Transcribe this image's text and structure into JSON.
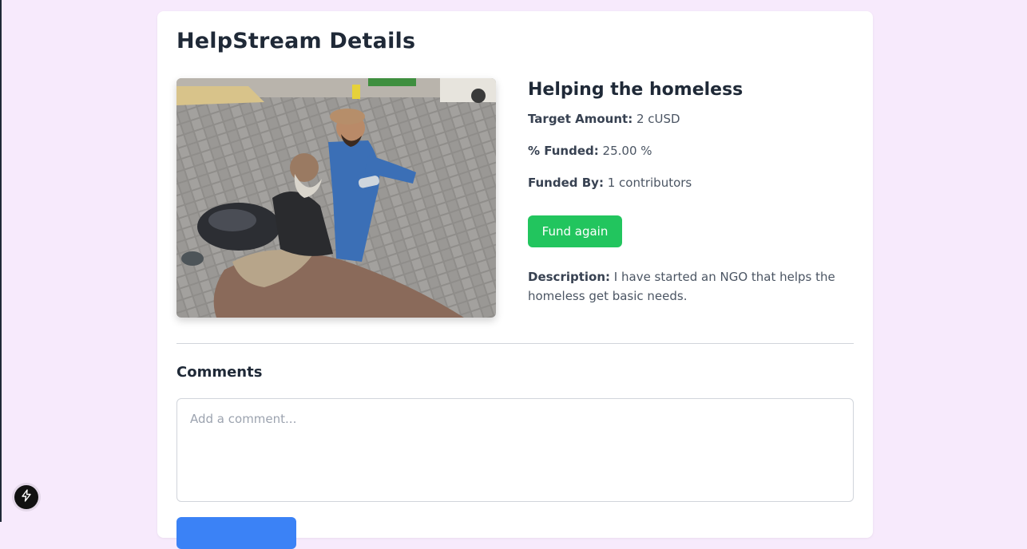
{
  "page": {
    "title": "HelpStream Details"
  },
  "campaign": {
    "title": "Helping the homeless",
    "image_alt": "Volunteer giving water to an elderly homeless man",
    "target_label": "Target Amount:",
    "target_value": "2 cUSD",
    "funded_label": "% Funded:",
    "funded_value": "25.00 %",
    "funded_by_label": "Funded By:",
    "funded_by_value": "1 contributors",
    "fund_button": "Fund again",
    "description_label": "Description:",
    "description_value": "I have started an NGO that helps the homeless get basic needs."
  },
  "comments": {
    "heading": "Comments",
    "placeholder": "Add a comment...",
    "value": ""
  },
  "colors": {
    "page_background": "#f7eafc",
    "fund_button": "#22c55e",
    "submit_button": "#3b82f6",
    "badge": "#111111"
  },
  "icons": {
    "dev_badge": "lightning-icon"
  }
}
